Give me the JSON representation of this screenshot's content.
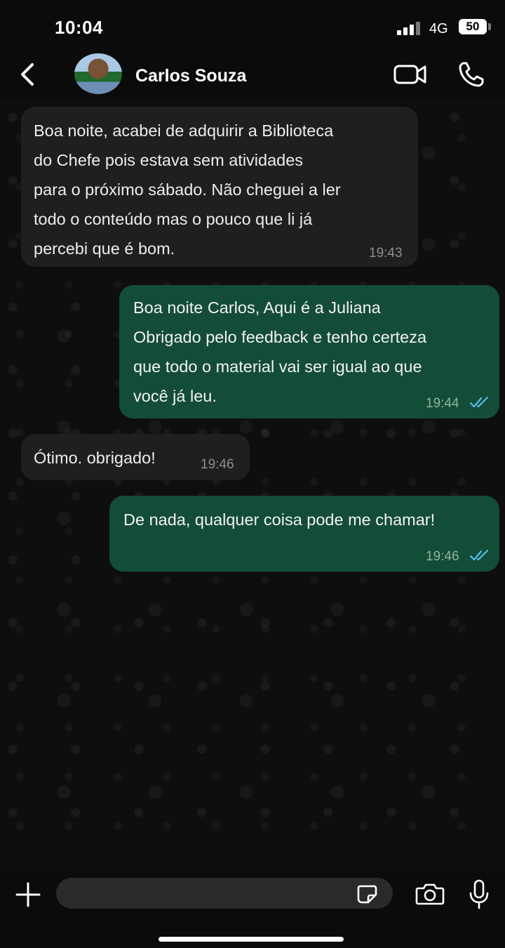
{
  "status_bar": {
    "time": "10:04",
    "network": "4G",
    "battery": "50"
  },
  "header": {
    "contact_name": "Carlos Souza",
    "back_icon": "chevron-left-icon",
    "video_icon": "video-camera-icon",
    "call_icon": "phone-icon"
  },
  "messages": [
    {
      "direction": "incoming",
      "lines": [
        "Boa noite, acabei de adquirir a Biblioteca",
        "do Chefe pois estava sem atividades",
        "para o próximo sábado. Não cheguei a ler",
        "todo o conteúdo mas o pouco que li já",
        "percebi que é bom."
      ],
      "time": "19:43"
    },
    {
      "direction": "outgoing",
      "lines": [
        "Boa noite Carlos, Aqui é a Juliana",
        "Obrigado pelo feedback e tenho certeza",
        "que todo o material vai ser igual ao que",
        "você já leu."
      ],
      "time": "19:44",
      "status": "read"
    },
    {
      "direction": "incoming",
      "lines": [
        "Ótimo. obrigado!"
      ],
      "time": "19:46"
    },
    {
      "direction": "outgoing",
      "lines": [
        "De nada, qualquer coisa pode me chamar!"
      ],
      "time": "19:46",
      "status": "read"
    }
  ],
  "composer": {
    "placeholder": "",
    "value": ""
  },
  "colors": {
    "outgoing_bubble": "#134d37",
    "incoming_bubble": "#1f1f1f",
    "read_ticks": "#53bdeb"
  }
}
